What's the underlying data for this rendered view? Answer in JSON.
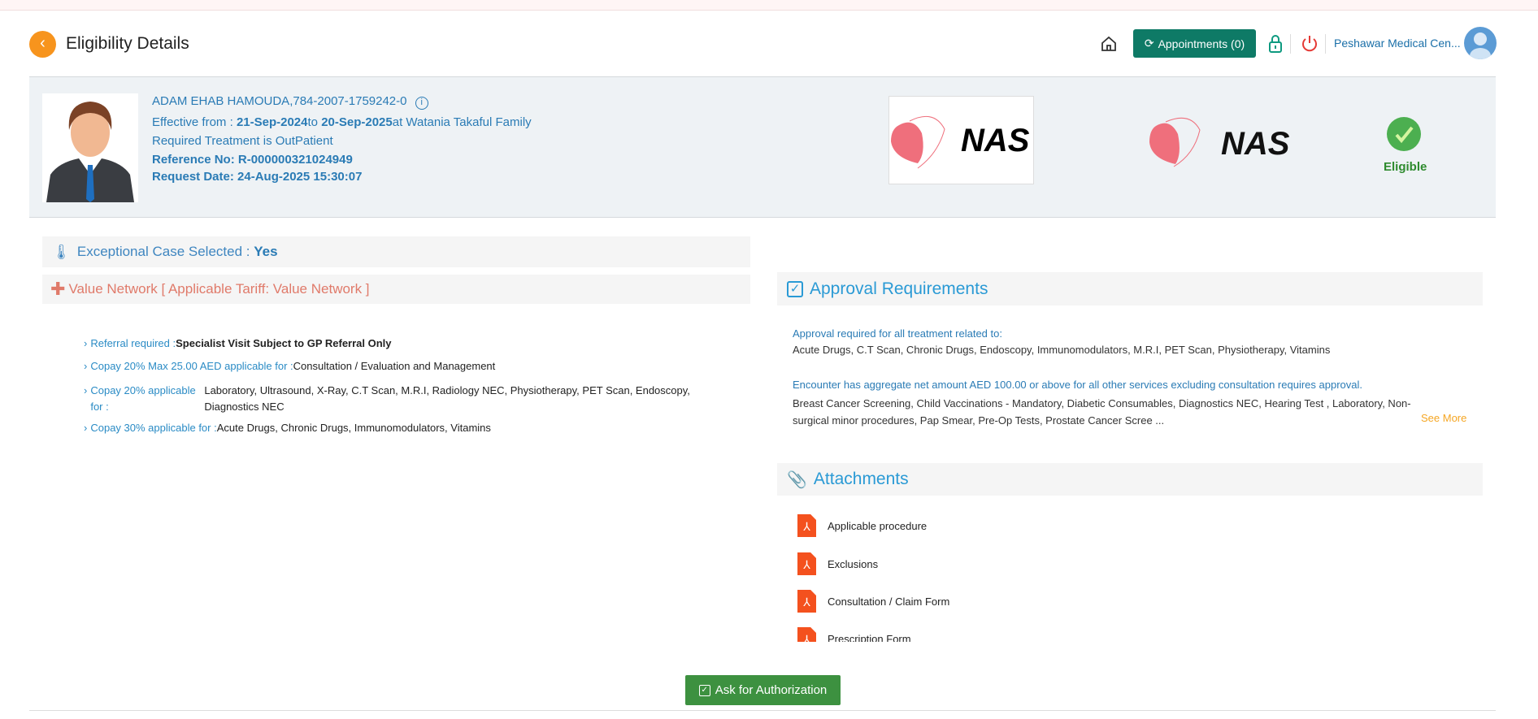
{
  "header": {
    "title": "Eligibility Details",
    "appointments_label": "Appointments (0)",
    "organization": "Peshawar Medical Cen..."
  },
  "member": {
    "name": "ADAM EHAB HAMOUDA",
    "id": ",784-2007-1759242-0",
    "effective_label": "Effective from : ",
    "effective_from": "21-Sep-2024",
    "to_label": "to ",
    "effective_to": "20-Sep-2025",
    "at_label": "at Watania Takaful Family",
    "treatment": "Required Treatment is OutPatient",
    "reference": "Reference No: R-000000321024949",
    "request_date": "Request Date: 24-Aug-2025 15:30:07"
  },
  "logos": {
    "payer": "NAS",
    "network": "NAS"
  },
  "status": {
    "label": "Eligible",
    "color": "#4caf50"
  },
  "exceptional": {
    "label": "Exceptional Case Selected : ",
    "value": "Yes"
  },
  "network": {
    "label": "Value Network [ Applicable Tariff: Value Network ]"
  },
  "benefits": [
    {
      "label": "Referral required :",
      "value": "Specialist Visit Subject to GP Referral Only"
    },
    {
      "label": "Copay 20% Max 25.00 AED applicable for :",
      "value": "Consultation / Evaluation and Management"
    },
    {
      "label": "Copay 20% applicable for :",
      "value": "Laboratory, Ultrasound, X-Ray, C.T Scan, M.R.I, Radiology NEC, Physiotherapy, PET Scan, Endoscopy, Diagnostics NEC"
    },
    {
      "label": "Copay 30% applicable for :",
      "value": "Acute Drugs, Chronic Drugs, Immunomodulators, Vitamins"
    }
  ],
  "approval": {
    "title": "Approval Requirements",
    "rule1": "Approval required for all treatment related to:",
    "items1": "Acute Drugs, C.T Scan, Chronic Drugs, Endoscopy, Immunomodulators, M.R.I, PET Scan, Physiotherapy, Vitamins",
    "rule2": "Encounter has aggregate net amount AED 100.00 or above for all other services excluding consultation requires approval.",
    "items2": "Breast Cancer Screening, Child Vaccinations - Mandatory, Diabetic Consumables, Diagnostics NEC, Hearing Test , Laboratory, Non-surgical minor procedures, Pap Smear, Pre-Op Tests, Prostate Cancer Scree ...",
    "see_more": "See More"
  },
  "attachments": {
    "title": "Attachments",
    "items": [
      "Applicable procedure",
      "Exclusions",
      "Consultation / Claim Form",
      "Prescription Form"
    ]
  },
  "actions": {
    "authorize": "Ask for Authorization"
  }
}
